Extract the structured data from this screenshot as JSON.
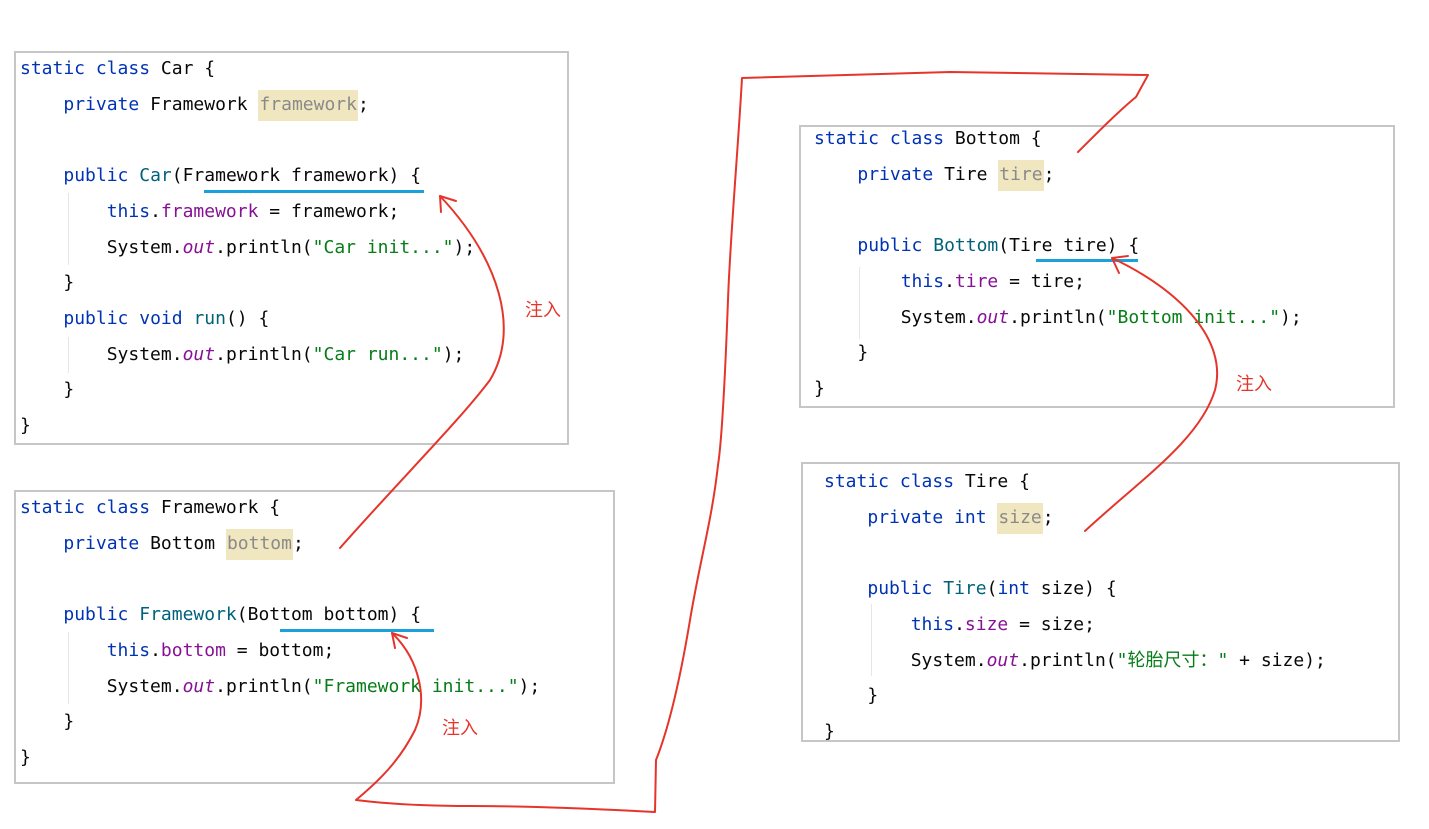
{
  "car_box": {
    "lines": [
      [
        "static class Car {"
      ],
      [
        "    private Framework framework;"
      ],
      [
        ""
      ],
      [
        "    public Car(Framework framework) {"
      ],
      [
        "        this.framework = framework;"
      ],
      [
        "        System.out.println(\"Car init...\");"
      ],
      [
        "    }"
      ],
      [
        "    public void run() {"
      ],
      [
        "        System.out.println(\"Car run...\");"
      ],
      [
        "    }"
      ],
      [
        "}"
      ]
    ]
  },
  "framework_box": {
    "lines": [
      [
        "static class Framework {"
      ],
      [
        "    private Bottom bottom;"
      ],
      [
        ""
      ],
      [
        "    public Framework(Bottom bottom) {"
      ],
      [
        "        this.bottom = bottom;"
      ],
      [
        "        System.out.println(\"Framework init...\");"
      ],
      [
        "    }"
      ],
      [
        "}"
      ]
    ]
  },
  "bottom_box": {
    "lines": [
      [
        "static class Bottom {"
      ],
      [
        "    private Tire tire;"
      ],
      [
        ""
      ],
      [
        "    public Bottom(Tire tire) {"
      ],
      [
        "        this.tire = tire;"
      ],
      [
        "        System.out.println(\"Bottom init...\");"
      ],
      [
        "    }"
      ],
      [
        "}"
      ]
    ]
  },
  "tire_box": {
    "lines": [
      [
        "static class Tire {"
      ],
      [
        "    private int size;"
      ],
      [
        ""
      ],
      [
        "    public Tire(int size) {"
      ],
      [
        "        this.size = size;"
      ],
      [
        "        System.out.println(\"轮胎尺寸：\" + size);"
      ],
      [
        "    }"
      ],
      [
        "}"
      ]
    ]
  },
  "annotations": {
    "inject_1": "注入",
    "inject_2": "注入",
    "inject_3": "注入"
  },
  "colors": {
    "keyword": "#0033b3",
    "field": "#871094",
    "method": "#00627a",
    "string": "#067d17",
    "highlight_bg": "#f0e6c0",
    "arrow": "#e5352b",
    "underline": "#1aa0dc"
  }
}
